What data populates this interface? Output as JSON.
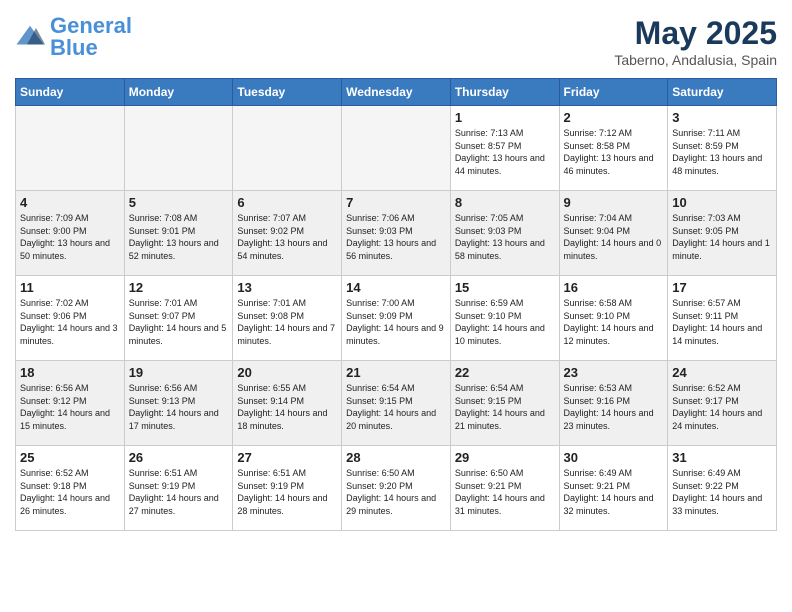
{
  "header": {
    "logo_general": "General",
    "logo_blue": "Blue",
    "month_title": "May 2025",
    "location": "Taberno, Andalusia, Spain"
  },
  "days_of_week": [
    "Sunday",
    "Monday",
    "Tuesday",
    "Wednesday",
    "Thursday",
    "Friday",
    "Saturday"
  ],
  "weeks": [
    [
      {
        "day": "",
        "empty": true
      },
      {
        "day": "",
        "empty": true
      },
      {
        "day": "",
        "empty": true
      },
      {
        "day": "",
        "empty": true
      },
      {
        "day": "1",
        "sunrise": "7:13 AM",
        "sunset": "8:57 PM",
        "daylight": "13 hours and 44 minutes."
      },
      {
        "day": "2",
        "sunrise": "7:12 AM",
        "sunset": "8:58 PM",
        "daylight": "13 hours and 46 minutes."
      },
      {
        "day": "3",
        "sunrise": "7:11 AM",
        "sunset": "8:59 PM",
        "daylight": "13 hours and 48 minutes."
      }
    ],
    [
      {
        "day": "4",
        "sunrise": "7:09 AM",
        "sunset": "9:00 PM",
        "daylight": "13 hours and 50 minutes."
      },
      {
        "day": "5",
        "sunrise": "7:08 AM",
        "sunset": "9:01 PM",
        "daylight": "13 hours and 52 minutes."
      },
      {
        "day": "6",
        "sunrise": "7:07 AM",
        "sunset": "9:02 PM",
        "daylight": "13 hours and 54 minutes."
      },
      {
        "day": "7",
        "sunrise": "7:06 AM",
        "sunset": "9:03 PM",
        "daylight": "13 hours and 56 minutes."
      },
      {
        "day": "8",
        "sunrise": "7:05 AM",
        "sunset": "9:03 PM",
        "daylight": "13 hours and 58 minutes."
      },
      {
        "day": "9",
        "sunrise": "7:04 AM",
        "sunset": "9:04 PM",
        "daylight": "14 hours and 0 minutes."
      },
      {
        "day": "10",
        "sunrise": "7:03 AM",
        "sunset": "9:05 PM",
        "daylight": "14 hours and 1 minute."
      }
    ],
    [
      {
        "day": "11",
        "sunrise": "7:02 AM",
        "sunset": "9:06 PM",
        "daylight": "14 hours and 3 minutes."
      },
      {
        "day": "12",
        "sunrise": "7:01 AM",
        "sunset": "9:07 PM",
        "daylight": "14 hours and 5 minutes."
      },
      {
        "day": "13",
        "sunrise": "7:01 AM",
        "sunset": "9:08 PM",
        "daylight": "14 hours and 7 minutes."
      },
      {
        "day": "14",
        "sunrise": "7:00 AM",
        "sunset": "9:09 PM",
        "daylight": "14 hours and 9 minutes."
      },
      {
        "day": "15",
        "sunrise": "6:59 AM",
        "sunset": "9:10 PM",
        "daylight": "14 hours and 10 minutes."
      },
      {
        "day": "16",
        "sunrise": "6:58 AM",
        "sunset": "9:10 PM",
        "daylight": "14 hours and 12 minutes."
      },
      {
        "day": "17",
        "sunrise": "6:57 AM",
        "sunset": "9:11 PM",
        "daylight": "14 hours and 14 minutes."
      }
    ],
    [
      {
        "day": "18",
        "sunrise": "6:56 AM",
        "sunset": "9:12 PM",
        "daylight": "14 hours and 15 minutes."
      },
      {
        "day": "19",
        "sunrise": "6:56 AM",
        "sunset": "9:13 PM",
        "daylight": "14 hours and 17 minutes."
      },
      {
        "day": "20",
        "sunrise": "6:55 AM",
        "sunset": "9:14 PM",
        "daylight": "14 hours and 18 minutes."
      },
      {
        "day": "21",
        "sunrise": "6:54 AM",
        "sunset": "9:15 PM",
        "daylight": "14 hours and 20 minutes."
      },
      {
        "day": "22",
        "sunrise": "6:54 AM",
        "sunset": "9:15 PM",
        "daylight": "14 hours and 21 minutes."
      },
      {
        "day": "23",
        "sunrise": "6:53 AM",
        "sunset": "9:16 PM",
        "daylight": "14 hours and 23 minutes."
      },
      {
        "day": "24",
        "sunrise": "6:52 AM",
        "sunset": "9:17 PM",
        "daylight": "14 hours and 24 minutes."
      }
    ],
    [
      {
        "day": "25",
        "sunrise": "6:52 AM",
        "sunset": "9:18 PM",
        "daylight": "14 hours and 26 minutes."
      },
      {
        "day": "26",
        "sunrise": "6:51 AM",
        "sunset": "9:19 PM",
        "daylight": "14 hours and 27 minutes."
      },
      {
        "day": "27",
        "sunrise": "6:51 AM",
        "sunset": "9:19 PM",
        "daylight": "14 hours and 28 minutes."
      },
      {
        "day": "28",
        "sunrise": "6:50 AM",
        "sunset": "9:20 PM",
        "daylight": "14 hours and 29 minutes."
      },
      {
        "day": "29",
        "sunrise": "6:50 AM",
        "sunset": "9:21 PM",
        "daylight": "14 hours and 31 minutes."
      },
      {
        "day": "30",
        "sunrise": "6:49 AM",
        "sunset": "9:21 PM",
        "daylight": "14 hours and 32 minutes."
      },
      {
        "day": "31",
        "sunrise": "6:49 AM",
        "sunset": "9:22 PM",
        "daylight": "14 hours and 33 minutes."
      }
    ]
  ]
}
